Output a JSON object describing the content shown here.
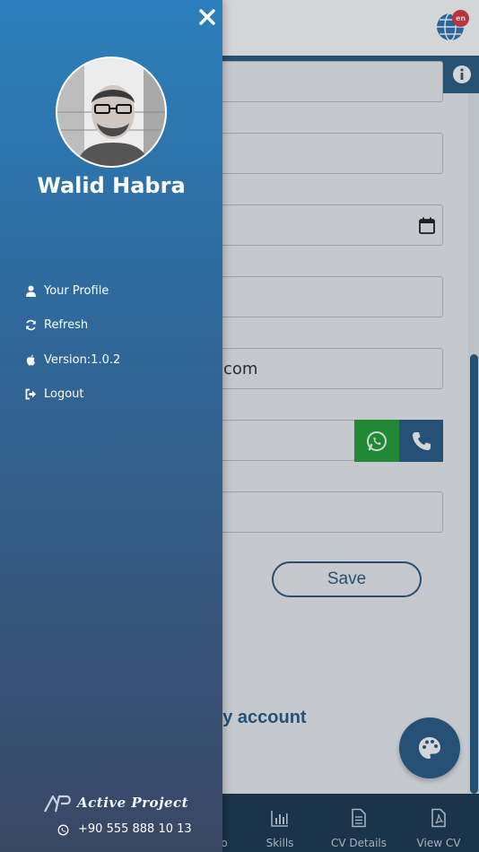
{
  "app": {
    "lang_badge": "en",
    "fields": {
      "email_value": "com"
    },
    "save_label": "Save",
    "account_link": "ny account",
    "bottom_nav": [
      {
        "label": "o",
        "icon": "info-icon"
      },
      {
        "label": "Skills",
        "icon": "bar-chart-icon"
      },
      {
        "label": "CV Details",
        "icon": "document-icon"
      },
      {
        "label": "View CV",
        "icon": "pdf-icon"
      }
    ]
  },
  "drawer": {
    "user_name": "Walid Habra",
    "menu": [
      {
        "label": "Your Profile",
        "icon": "user-icon"
      },
      {
        "label": "Refresh",
        "icon": "refresh-icon"
      },
      {
        "label": "Version:1.0.2",
        "icon": "apple-icon"
      },
      {
        "label": "Logout",
        "icon": "logout-icon"
      }
    ],
    "brand_name": "Active Project",
    "phone": "+90 555 888 10 13"
  },
  "colors": {
    "drawer_top": "#2b7fbc",
    "drawer_bottom": "#3a4764",
    "primary": "#2a5f88",
    "whatsapp": "#27a137",
    "badge": "#e03a48"
  }
}
